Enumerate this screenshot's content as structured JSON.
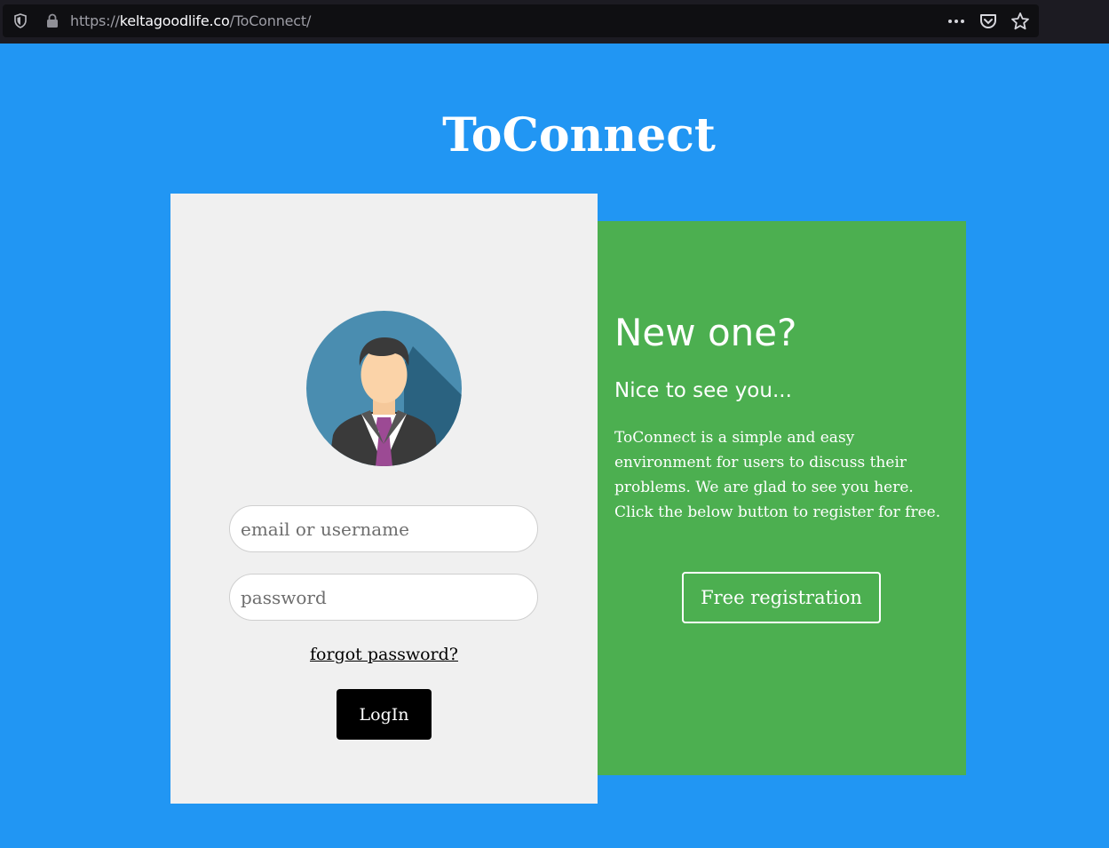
{
  "browser": {
    "url_prefix": "https://",
    "url_domain": "keltagoodlife.co",
    "url_path": "/ToConnect/"
  },
  "page": {
    "title": "ToConnect"
  },
  "login": {
    "email_placeholder": "email or username",
    "password_placeholder": "password",
    "forgot_label": "forgot password?",
    "login_label": "LogIn"
  },
  "register": {
    "heading": "New one?",
    "subheading": "Nice to see you...",
    "description": "ToConnect is a simple and easy environment for users to discuss their problems. We are glad to see you here. Click the below button to register for free.",
    "button_label": "Free registration"
  },
  "colors": {
    "background": "#2196f3",
    "login_card": "#f0f0f0",
    "register_card": "#4caf50"
  }
}
